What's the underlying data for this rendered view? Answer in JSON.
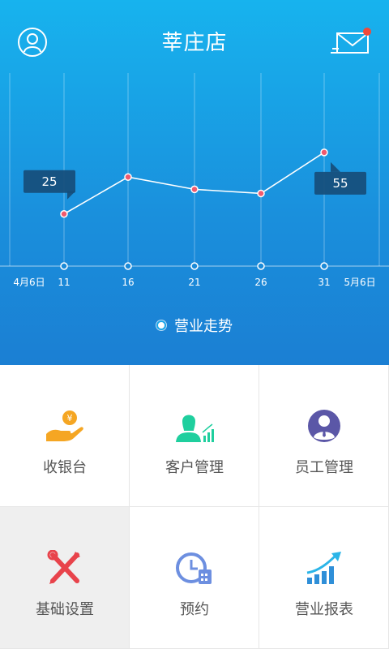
{
  "header": {
    "title": "莘庄店",
    "notification_dot_color": "#f04a3a"
  },
  "chart_data": {
    "type": "line",
    "x_labels": [
      "4月6日",
      "11",
      "16",
      "21",
      "26",
      "31",
      "5月6日"
    ],
    "points": [
      {
        "x": "11",
        "y": 25
      },
      {
        "x": "16",
        "y": 43
      },
      {
        "x": "21",
        "y": 37
      },
      {
        "x": "26",
        "y": 35
      },
      {
        "x": "31",
        "y": 55
      }
    ],
    "callouts": [
      {
        "x": "11",
        "label": "25"
      },
      {
        "x": "31",
        "label": "55"
      }
    ],
    "legend": "营业走势",
    "grid": true
  },
  "menu": [
    {
      "label": "收银台",
      "icon": "cashier-hand-coin-icon"
    },
    {
      "label": "客户管理",
      "icon": "customer-chart-icon"
    },
    {
      "label": "员工管理",
      "icon": "staff-person-icon"
    },
    {
      "label": "基础设置",
      "icon": "tools-wrench-icon"
    },
    {
      "label": "预约",
      "icon": "clock-calendar-icon"
    },
    {
      "label": "营业报表",
      "icon": "report-bar-chart-icon"
    }
  ]
}
